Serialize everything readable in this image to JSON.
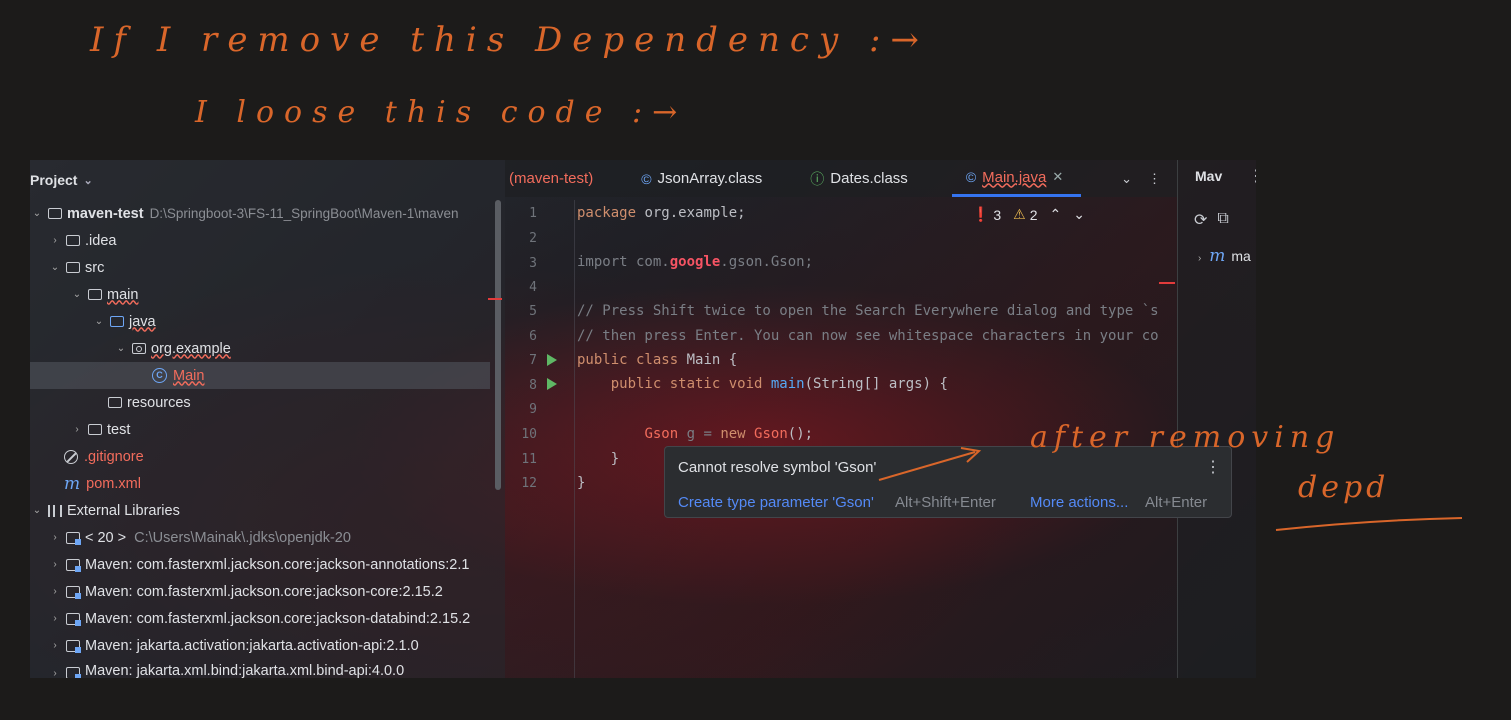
{
  "annotations": {
    "line1": "If I remove this Dependency :→",
    "line2": "I loose this code :→",
    "side1": "after removing",
    "side2": "depd"
  },
  "project": {
    "header": "Project",
    "tree": [
      {
        "label": "maven-test",
        "extra": "D:\\Springboot-3\\FS-11_SpringBoot\\Maven-1\\maven"
      },
      {
        "label": ".idea"
      },
      {
        "label": "src"
      },
      {
        "label": "main"
      },
      {
        "label": "java"
      },
      {
        "label": "org.example"
      },
      {
        "label": "Main"
      },
      {
        "label": "resources"
      },
      {
        "label": "test"
      },
      {
        "label": ".gitignore"
      },
      {
        "label": "pom.xml"
      },
      {
        "label": "External Libraries"
      },
      {
        "label": "< 20 >",
        "extra": "C:\\Users\\Mainak\\.jdks\\openjdk-20"
      },
      {
        "label": "Maven: com.fasterxml.jackson.core:jackson-annotations:2.1"
      },
      {
        "label": "Maven: com.fasterxml.jackson.core:jackson-core:2.15.2"
      },
      {
        "label": "Maven: com.fasterxml.jackson.core:jackson-databind:2.15.2"
      },
      {
        "label": "Maven: jakarta.activation:jakarta.activation-api:2.1.0"
      },
      {
        "label": "Maven: jakarta.xml.bind:jakarta.xml.bind-api:4.0.0"
      }
    ]
  },
  "editor": {
    "tabs": [
      {
        "label": "(maven-test)"
      },
      {
        "label": "JsonArray.class"
      },
      {
        "label": "Dates.class"
      },
      {
        "label": "Main.java"
      }
    ],
    "inspections": {
      "errors": "3",
      "warnings": "2"
    },
    "line_numbers": [
      "1",
      "2",
      "3",
      "4",
      "5",
      "6",
      "7",
      "8",
      "9",
      "10",
      "11",
      "12"
    ],
    "code": {
      "l1_kw": "package",
      "l1_rest": " org.example;",
      "l3_a": "import com.",
      "l3_b": "google",
      "l3_c": ".gson.Gson;",
      "l5": "// Press Shift twice to open the Search Everywhere dialog and type `s",
      "l6": "// then press Enter. You can now see whitespace characters in your co",
      "l7_kw": "public class",
      "l7_rest": " Main {",
      "l8_kw": "    public static void",
      "l8_fn": " main",
      "l8_rest": "(String[] args) {",
      "l10_a": "        ",
      "l10_t": "Gson",
      "l10_b": " g = ",
      "l10_kw": "new",
      "l10_c": " ",
      "l10_t2": "Gson",
      "l10_d": "();",
      "l11": "    }",
      "l12": "}"
    },
    "popup": {
      "message": "Cannot resolve symbol 'Gson'",
      "action1": "Create type parameter 'Gson'",
      "shortcut1": "Alt+Shift+Enter",
      "action2": "More actions...",
      "shortcut2": "Alt+Enter"
    }
  },
  "maven": {
    "title": "Mav",
    "item": "ma"
  },
  "colors": {
    "accent": "#3574f0",
    "error": "#f26c5c",
    "annotation": "#d9662a"
  }
}
